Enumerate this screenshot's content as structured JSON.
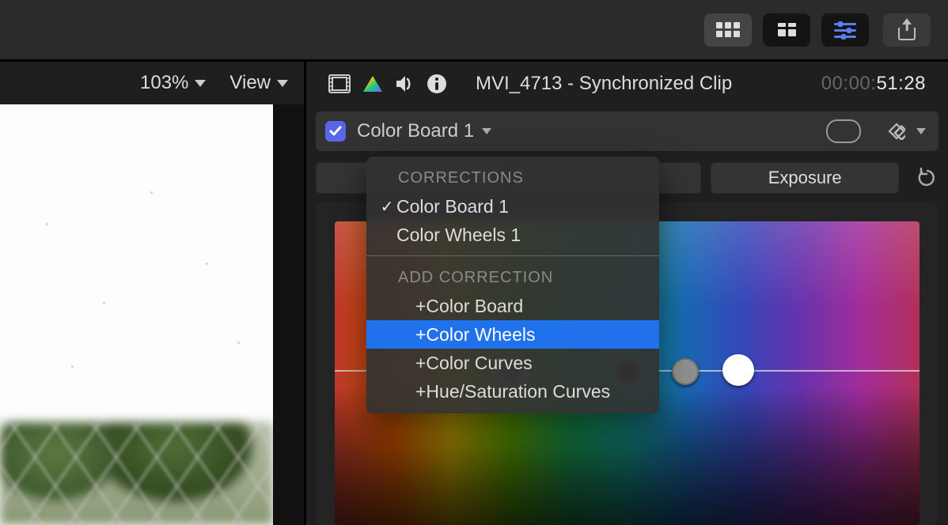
{
  "toolbar": {
    "grid_icon": "grid-6",
    "strip_icon": "grid-4",
    "sliders_icon": "sliders",
    "share_icon": "share"
  },
  "viewer": {
    "zoom": "103%",
    "view_label": "View"
  },
  "inspector": {
    "clip_name": "MVI_4713 - Synchronized Clip",
    "timecode_dim": "00:00:",
    "timecode_bright": "51:28",
    "checkbox_checked": true,
    "correction_name": "Color Board 1",
    "tab_exposure": "Exposure"
  },
  "menu": {
    "section_corrections": "CORRECTIONS",
    "section_add": "ADD CORRECTION",
    "items_corrections": [
      {
        "label": "Color Board 1",
        "checked": true
      },
      {
        "label": "Color Wheels 1",
        "checked": false
      }
    ],
    "items_add": [
      {
        "label": "+Color Board",
        "selected": false
      },
      {
        "label": "+Color Wheels",
        "selected": true
      },
      {
        "label": "+Color Curves",
        "selected": false
      },
      {
        "label": "+Hue/Saturation Curves",
        "selected": false
      }
    ]
  }
}
